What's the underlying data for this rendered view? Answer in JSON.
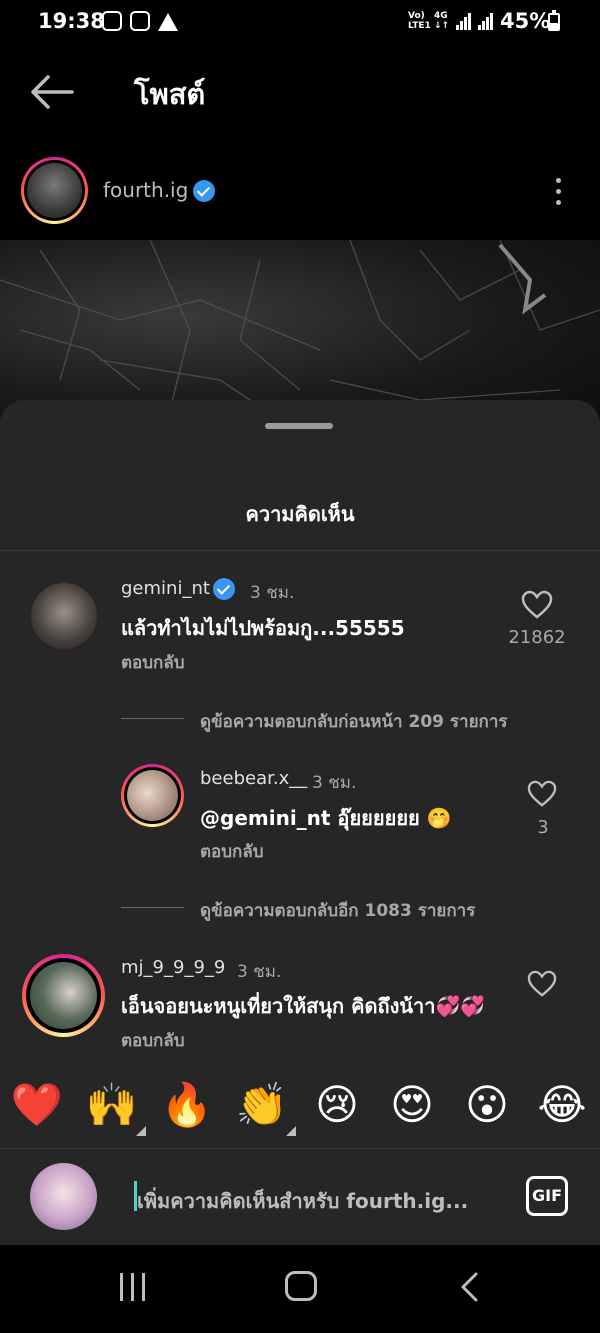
{
  "status": {
    "time": "19:38",
    "network_label_1": "Vo)\nLTE1",
    "network_label_2": "4G\n↓↑",
    "battery": "45%",
    "battery_level": 0.45
  },
  "header": {
    "title": "โพสต์",
    "back_icon": "arrow-left-icon"
  },
  "post": {
    "author": "fourth.ig",
    "verified": true
  },
  "sheet": {
    "title": "ความคิดเห็น"
  },
  "comments": [
    {
      "user": "gemini_nt",
      "verified": true,
      "time": "3 ชม.",
      "text": "แล้วทำไมไม่ไปพร้อมกู...55555",
      "reply": "ตอบกลับ",
      "likes": "21862"
    },
    {
      "view_replies": "ดูข้อความตอบกลับก่อนหน้า 209 รายการ"
    },
    {
      "user": "beebear.x__",
      "time": "3 ชม.",
      "text": "@gemini_nt อุ๊ยยยยยย",
      "emoji": "🤭",
      "reply": "ตอบกลับ",
      "likes": "3"
    },
    {
      "view_replies": "ดูข้อความตอบกลับอีก 1083 รายการ"
    },
    {
      "user": "mj_9_9_9_9",
      "time": "3 ชม.",
      "text": "เอ็นจอยนะหนูเที่ยวให้สนุก คิดถึงน้าา",
      "emoji": "💞💞",
      "reply": "ตอบกลับ"
    }
  ],
  "emoji_bar": [
    "❤️",
    "🙌",
    "🔥",
    "👏",
    "😢",
    "😍",
    "😮",
    "😂"
  ],
  "input": {
    "placeholder": "เพิ่มความคิดเห็นสำหรับ fourth.ig...",
    "gif_label": "GIF"
  },
  "colors": {
    "background": "#000000",
    "sheet": "#262626",
    "verified": "#3897f0",
    "secondary_text": "#a8a8a8"
  }
}
